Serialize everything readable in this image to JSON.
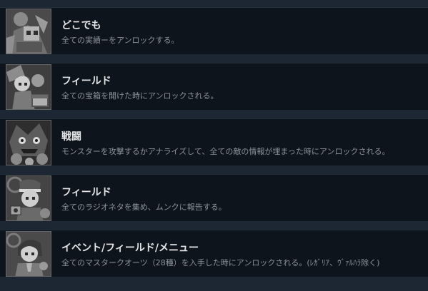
{
  "achievements": [
    {
      "title": "どこでも",
      "description": "全ての実績ーをアンロックする。",
      "icon": "grayscale-character-art-icon"
    },
    {
      "title": "フィールド",
      "description": "全ての宝箱を開けた時にアンロックされる。",
      "icon": "grayscale-treasure-character-icon"
    },
    {
      "title": "戦闘",
      "description": "モンスターを攻撃するかアナライズして、全ての敵の情報が埋まった時にアンロックされる。",
      "icon": "grayscale-monster-icon"
    },
    {
      "title": "フィールド",
      "description": "全てのラジオネタを集め、ムンクに報告する。",
      "icon": "grayscale-radio-character-icon"
    },
    {
      "title": "イベント/フィールド/メニュー",
      "description": "全てのマスタークオーツ（28種）を入手した時にアンロックされる。(ﾚｶﾞﾘｱ、ｳﾞｧﾙﾊﾗ除く)",
      "icon": "grayscale-quartz-character-icon"
    }
  ],
  "colors": {
    "background": "#1c2733",
    "row_background": "#0e141b",
    "title": "#e2e4e6",
    "description": "#8a929b",
    "icon_frame": "#666666"
  }
}
